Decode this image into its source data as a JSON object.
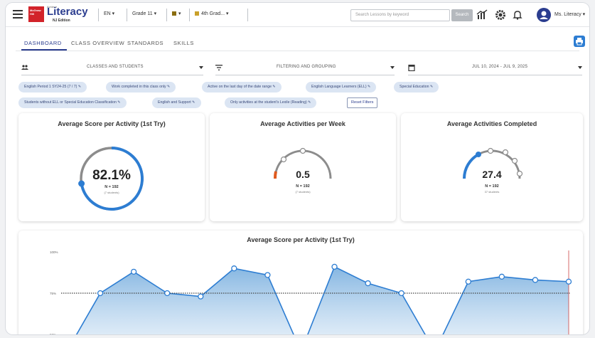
{
  "header": {
    "logo_brand": "McGraw Hill",
    "logo_super": "Achieve",
    "logo_title": "Literacy",
    "logo_edition": "NJ Edition",
    "language": "EN",
    "grade": "Grade 11",
    "class_selector": "4th Grad...",
    "search_placeholder": "Search Lessons by keyword",
    "search_button": "Search",
    "user_name": "Ms. Literacy"
  },
  "tabs": [
    {
      "label": "DASHBOARD",
      "active": true
    },
    {
      "label": "CLASS OVERVIEW",
      "active": false
    },
    {
      "label": "STANDARDS",
      "active": false
    },
    {
      "label": "SKILLS",
      "active": false
    }
  ],
  "filters": {
    "classes_label": "CLASSES AND STUDENTS",
    "filter_label": "FILTERING AND GROUPING",
    "date_label": "JUL 10, 2024 - JUL 9, 2025"
  },
  "chips": [
    "English Period 1 SY24-25 (7 / 7)",
    "Work completed in this class only",
    "Active on the last day of the date range",
    "English Language Learners (ELL)",
    "Special Education",
    "Students without ELL or Special Education Classification",
    "English and Support",
    "Only activities at the student's Lexile (Reading)"
  ],
  "reset_label": "Reset Filters",
  "cards": [
    {
      "title": "Average Score per Activity (1st Try)",
      "value": "82.1%",
      "n": "N = 192",
      "sub": "(7 students)"
    },
    {
      "title": "Average Activities per Week",
      "value": "0.5",
      "n": "N = 192",
      "sub": "(7 students)"
    },
    {
      "title": "Average Activities Completed",
      "value": "27.4",
      "n": "N = 192",
      "sub": "37 students"
    }
  ],
  "colors": {
    "accent": "#2b3d8f",
    "gauge_blue": "#2d7dd2",
    "gauge_gray": "#8c8c8c",
    "gauge_orange": "#e05a1e"
  },
  "chart_data": {
    "type": "area",
    "title": "Average Score per Activity (1st Try)",
    "ytick_labels": [
      "100%",
      "75%",
      "50%"
    ],
    "ylim": [
      25,
      100
    ],
    "reference_line": 75,
    "values": [
      null,
      75,
      88,
      75,
      73,
      90,
      86,
      null,
      91,
      81,
      75,
      null,
      82,
      85,
      83,
      82
    ]
  }
}
